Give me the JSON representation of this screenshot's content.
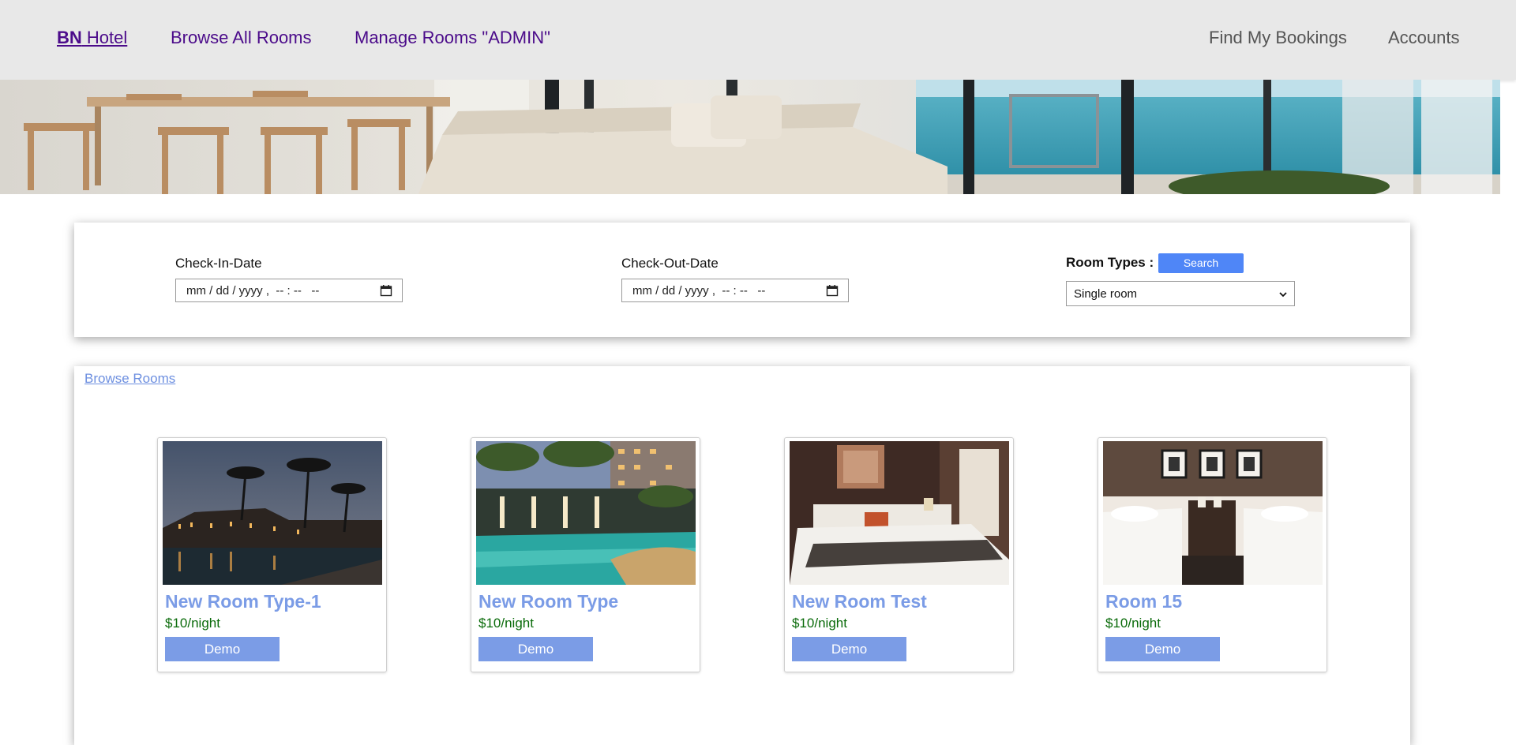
{
  "navbar": {
    "brand_bold": "BN",
    "brand_rest": " Hotel",
    "browse_all": "Browse All Rooms",
    "manage_rooms": "Manage Rooms \"ADMIN\"",
    "find_bookings": "Find My Bookings",
    "accounts": "Accounts"
  },
  "search": {
    "checkin_label": "Check-In-Date",
    "checkin_value": "mm / dd / yyyy ,  -- : --   --",
    "checkout_label": "Check-Out-Date",
    "checkout_value": "mm / dd / yyyy ,  -- : --   --",
    "room_types_label": "Room Types :",
    "search_button": "Search",
    "room_type_selected": "Single room",
    "calendar_icon": "calendar-icon"
  },
  "rooms": {
    "browse_link": "Browse Rooms",
    "items": [
      {
        "name": "New Room Type-1",
        "price": "$10/night",
        "button": "Demo"
      },
      {
        "name": "New Room Type",
        "price": "$10/night",
        "button": "Demo"
      },
      {
        "name": "New Room Test",
        "price": "$10/night",
        "button": "Demo"
      },
      {
        "name": "Room 15",
        "price": "$10/night",
        "button": "Demo"
      }
    ]
  },
  "colors": {
    "nav_bg": "#e8e8e8",
    "nav_link": "#4b0b8a",
    "accent_blue": "#4f86f7",
    "room_blue": "#7b9ce6",
    "price_green": "#0a6b0a"
  }
}
